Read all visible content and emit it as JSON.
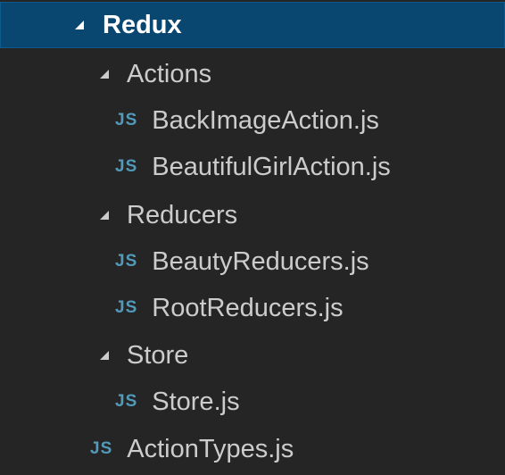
{
  "explorer": {
    "folders": {
      "redux": {
        "name": "Redux",
        "expanded": true,
        "selected": true
      },
      "actions": {
        "name": "Actions",
        "expanded": true
      },
      "reducers": {
        "name": "Reducers",
        "expanded": true
      },
      "store": {
        "name": "Store",
        "expanded": true
      }
    },
    "files": {
      "back_image_action": {
        "name": "BackImageAction.js",
        "icon": "JS"
      },
      "beautiful_girl_action": {
        "name": "BeautifulGirlAction.js",
        "icon": "JS"
      },
      "beauty_reducers": {
        "name": "BeautyReducers.js",
        "icon": "JS"
      },
      "root_reducers": {
        "name": "RootReducers.js",
        "icon": "JS"
      },
      "store_js": {
        "name": "Store.js",
        "icon": "JS"
      },
      "action_types": {
        "name": "ActionTypes.js",
        "icon": "JS"
      }
    }
  },
  "colors": {
    "background": "#252526",
    "selection": "#094771",
    "js_icon": "#519aba",
    "text": "#cccccc"
  }
}
